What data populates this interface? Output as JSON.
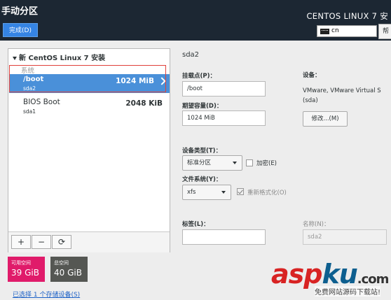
{
  "header": {
    "title": "手动分区",
    "product": "CENTOS LINUX 7 安",
    "done_label": "完成(D)",
    "keyboard": "cn",
    "help_label": "帮"
  },
  "tree": {
    "root_label": "新 CentOS Linux 7 安装",
    "section_label": "系统",
    "items": [
      {
        "name": "/boot",
        "device": "sda2",
        "size": "1024 MiB"
      },
      {
        "name": "BIOS Boot",
        "device": "sda1",
        "size": "2048 KiB"
      }
    ],
    "toolbar": {
      "add": "+",
      "remove": "−",
      "refresh": "⟳"
    }
  },
  "space": {
    "available_label": "可用空间",
    "available_value": "39 GiB",
    "total_label": "总空间",
    "total_value": "40 GiB"
  },
  "selected_link": "已选择 1 个存储设备(S)",
  "detail": {
    "title": "sda2",
    "mount_label": "挂载点(P)：",
    "mount_value": "/boot",
    "capacity_label": "期望容量(D)：",
    "capacity_value": "1024 MiB",
    "device_label": "设备：",
    "device_value": "VMware, VMware Virtual S",
    "device_sub": "(sda)",
    "modify_label": "修改...(M)",
    "device_type_label": "设备类型(T)：",
    "device_type_value": "标准分区",
    "encrypt_label": "加密(E)",
    "fs_label": "文件系统(Y)：",
    "fs_value": "xfs",
    "reformat_label": "重新格式化(O)",
    "tag_label": "标签(L)：",
    "tag_value": "",
    "name_label": "名称(N)：",
    "name_value": "sda2"
  },
  "watermark": {
    "brand_a": "asp",
    "brand_b": "ku",
    "brand_c": ".com",
    "tagline": "免费网站源码下载站!"
  }
}
